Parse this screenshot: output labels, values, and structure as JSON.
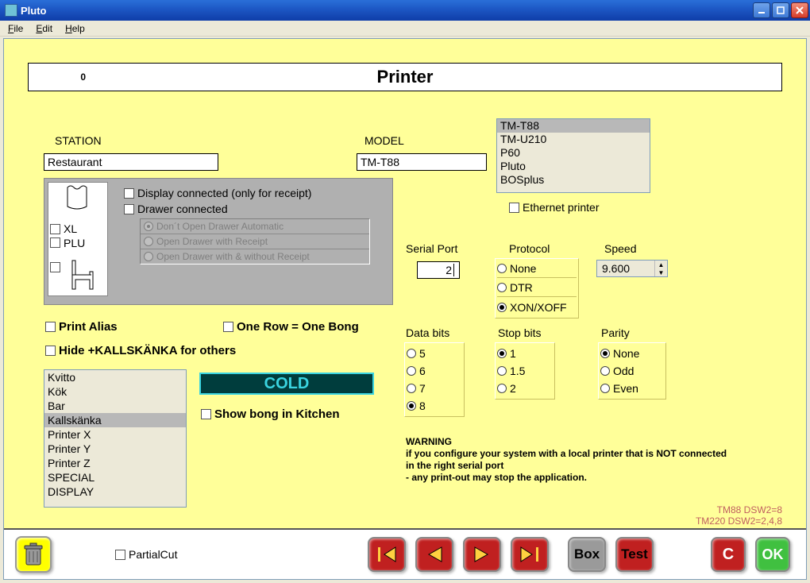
{
  "window": {
    "title": "Pluto"
  },
  "menu": {
    "file": "File",
    "edit": "Edit",
    "help": "Help"
  },
  "header": {
    "zero": "0",
    "title": "Printer"
  },
  "station": {
    "label": "STATION",
    "value": "Restaurant"
  },
  "model": {
    "label": "MODEL",
    "value": "TM-T88"
  },
  "model_list": {
    "items": [
      "TM-T88",
      "TM-U210",
      "P60",
      "Pluto",
      "BOSplus"
    ]
  },
  "xl_label": "XL",
  "plu_label": "PLU",
  "display_connected": "Display connected (only for receipt)",
  "drawer_connected": "Drawer connected",
  "drawer_opts": {
    "a": "Don´t Open Drawer Automatic",
    "b": "Open Drawer with Receipt",
    "c": "Open Drawer with & without Receipt"
  },
  "ethernet": "Ethernet printer",
  "print_alias": "Print Alias",
  "one_row": "One Row = One Bong",
  "hide_kall": "Hide +KALLSKÄNKA for others",
  "serial": {
    "label": "Serial Port",
    "value": "2"
  },
  "protocol": {
    "label": "Protocol",
    "none": "None",
    "dtr": "DTR",
    "xon": "XON/XOFF"
  },
  "speed": {
    "label": "Speed",
    "value": "9.600"
  },
  "databits": {
    "label": "Data bits",
    "b5": "5",
    "b6": "6",
    "b7": "7",
    "b8": "8"
  },
  "stopbits": {
    "label": "Stop bits",
    "s1": "1",
    "s15": "1.5",
    "s2": "2"
  },
  "parity": {
    "label": "Parity",
    "none": "None",
    "odd": "Odd",
    "even": "Even"
  },
  "cold": "COLD",
  "showbong": "Show bong in Kitchen",
  "plist": [
    "Kvitto",
    "Kök",
    "Bar",
    "Kallskänka",
    "Printer X",
    "Printer Y",
    "Printer Z",
    "SPECIAL",
    "DISPLAY"
  ],
  "plist_sel": "Kallskänka",
  "warn": {
    "h": "WARNING",
    "l1": "if you configure your system with a local printer that is NOT connected",
    "l2": "in the right serial port",
    "l3": " - any print-out may stop the application."
  },
  "dsw": {
    "a": "TM88   DSW2=8",
    "b": "TM220 DSW2=2,4,8"
  },
  "partialcut": "PartialCut",
  "boxbtn": "Box",
  "testbtn": "Test",
  "cbtn": "C",
  "okbtn": "OK"
}
